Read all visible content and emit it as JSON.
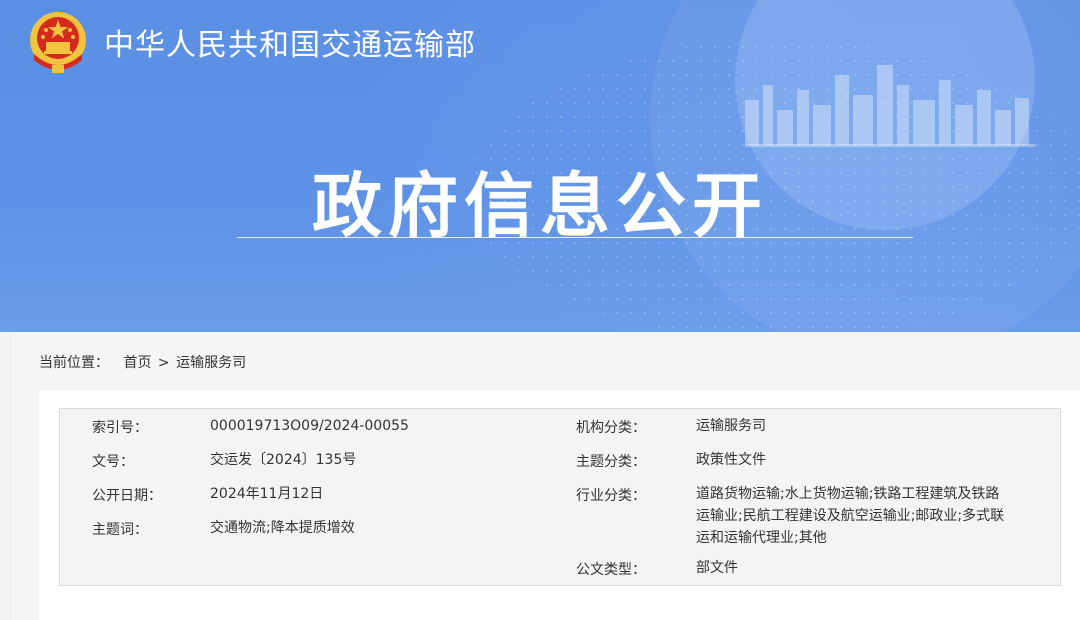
{
  "banner": {
    "ministry_name": "中华人民共和国交通运输部",
    "hero_title": "政府信息公开"
  },
  "breadcrumb": {
    "label": "当前位置：",
    "home": "首页",
    "separator": ">",
    "current": "运输服务司"
  },
  "info": {
    "index_label": "索引号：",
    "index_value": "000019713O09/2024-00055",
    "docno_label": "文号：",
    "docno_value": "交运发〔2024〕135号",
    "date_label": "公开日期：",
    "date_value": "2024年11月12日",
    "keywords_label": "主题词：",
    "keywords_value": "交通物流;降本提质增效",
    "org_label": "机构分类：",
    "org_value": "运输服务司",
    "topic_label": "主题分类：",
    "topic_value": "政策性文件",
    "industry_label": "行业分类：",
    "industry_line1": "道路货物运输;水上货物运输;铁路工程建筑及铁路",
    "industry_line2": "运输业;民航工程建设及航空运输业;邮政业;多式联",
    "industry_line3": "运和运输代理业;其他",
    "doctype_label": "公文类型：",
    "doctype_value": "部文件"
  },
  "colors": {
    "banner_blue": "#5b8fe4",
    "emblem_red": "#d52a1e",
    "emblem_gold": "#f2c341"
  },
  "icons": {
    "logo": "national-emblem-icon",
    "city": "city-skyline-icon"
  }
}
